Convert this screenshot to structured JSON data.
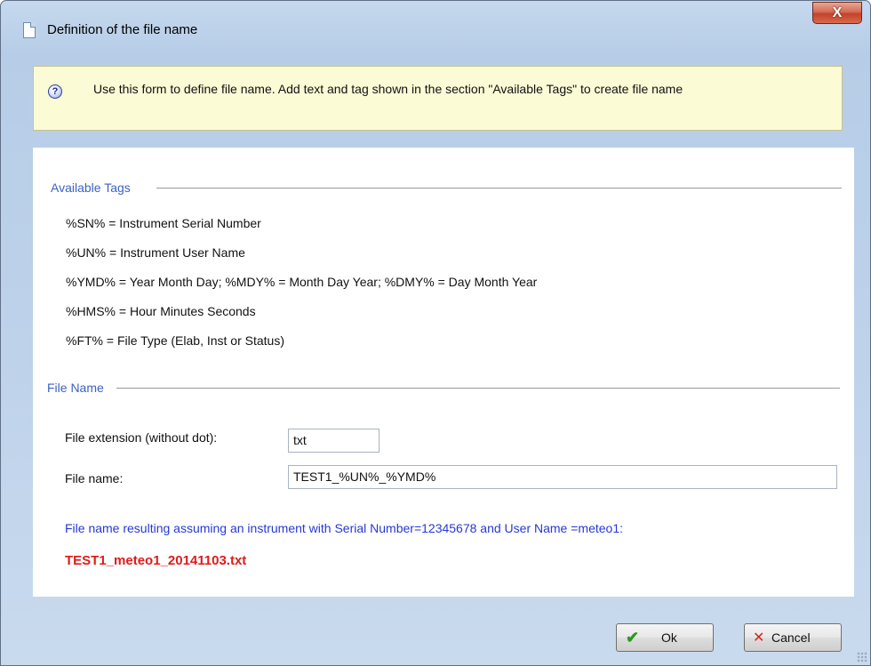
{
  "window": {
    "title": "Definition of the file name",
    "close_label": "X"
  },
  "info": {
    "icon": "question-icon",
    "text": "Use this form to define file name. Add text and tag shown in the section \"Available Tags\" to create file name"
  },
  "available_tags": {
    "header": "Available Tags",
    "items": [
      "%SN% = Instrument Serial Number",
      "%UN% = Instrument User Name",
      "%YMD% = Year Month Day; %MDY% = Month Day Year; %DMY% = Day Month Year",
      "%HMS% = Hour Minutes Seconds",
      "%FT% = File Type (Elab, Inst or Status)"
    ]
  },
  "file_name_section": {
    "header": "File Name",
    "extension_label": "File extension (without dot):",
    "extension_value": "txt",
    "name_label": "File name:",
    "name_value": "TEST1_%UN%_%YMD%",
    "result_description": "File name resulting assuming an instrument with Serial Number=12345678 and User Name =meteo1:",
    "result_value": "TEST1_meteo1_20141103.txt"
  },
  "buttons": {
    "ok_label": "Ok",
    "cancel_label": "Cancel"
  },
  "colors": {
    "section_header": "#3b62c3",
    "result_text": "#2638d6",
    "result_value": "#e01a1a",
    "info_background": "#fbfbd6"
  }
}
